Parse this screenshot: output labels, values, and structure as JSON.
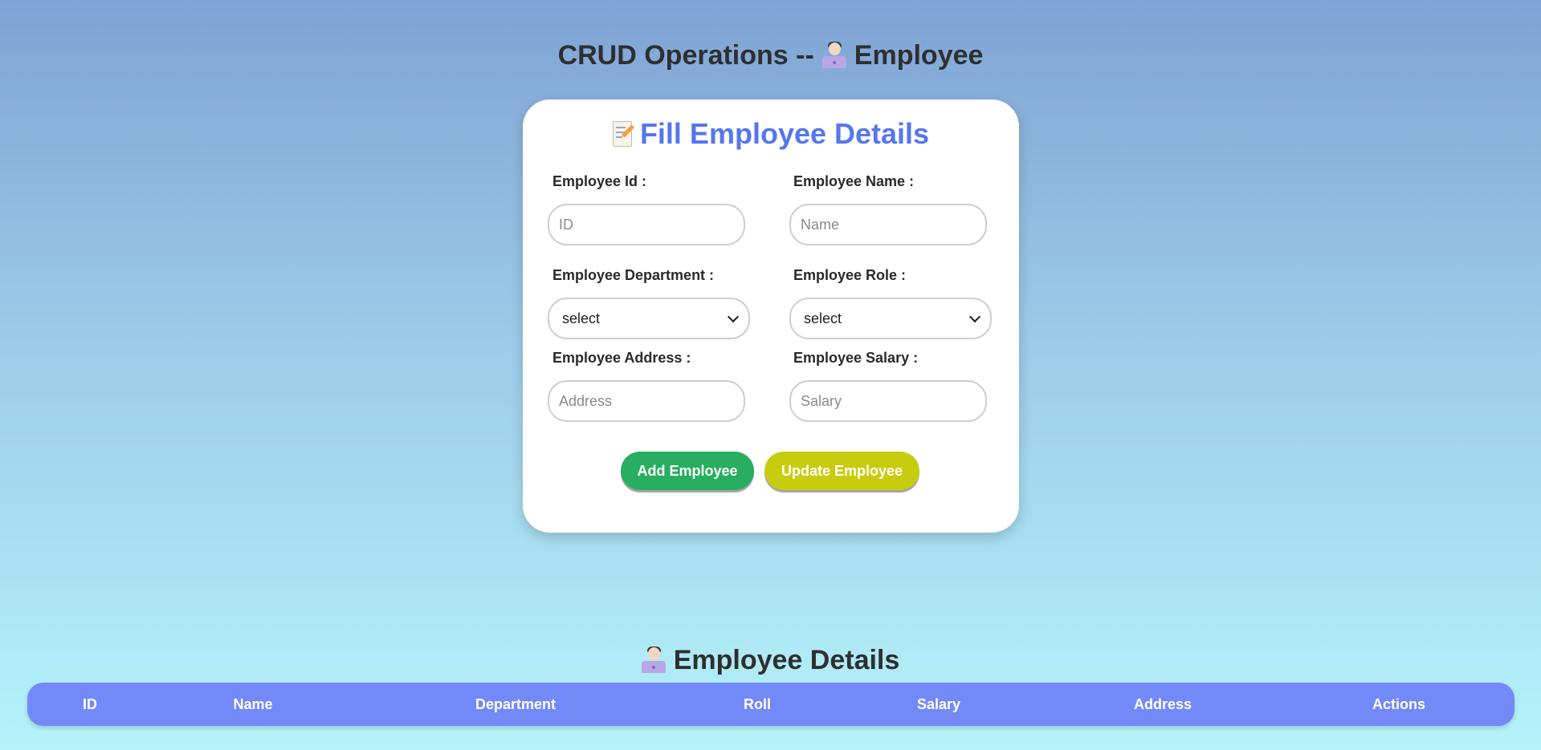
{
  "header": {
    "title": "CRUD Operations --",
    "title_suffix": "Employee",
    "title_icon": "person-with-laptop-icon"
  },
  "form": {
    "title": "Fill Employee Details",
    "title_icon": "memo-icon",
    "fields": {
      "id": {
        "label": "Employee Id :",
        "placeholder": "ID",
        "value": ""
      },
      "name": {
        "label": "Employee Name :",
        "placeholder": "Name",
        "value": ""
      },
      "department": {
        "label": "Employee Department :",
        "selected": "select"
      },
      "role": {
        "label": "Employee Role :",
        "selected": "select"
      },
      "address": {
        "label": "Employee Address :",
        "placeholder": "Address",
        "value": ""
      },
      "salary": {
        "label": "Employee Salary :",
        "placeholder": "Salary",
        "value": ""
      }
    },
    "buttons": {
      "add": "Add Employee",
      "update": "Update Employee"
    }
  },
  "details": {
    "title": "Employee Details",
    "title_icon": "person-with-laptop-icon",
    "columns": [
      "ID",
      "Name",
      "Department",
      "Roll",
      "Salary",
      "Address",
      "Actions"
    ],
    "rows": []
  },
  "colors": {
    "accent": "#5577ee",
    "table_header": "#7489f8",
    "add_button": "#27ae60",
    "update_button": "#c8cc0f"
  }
}
